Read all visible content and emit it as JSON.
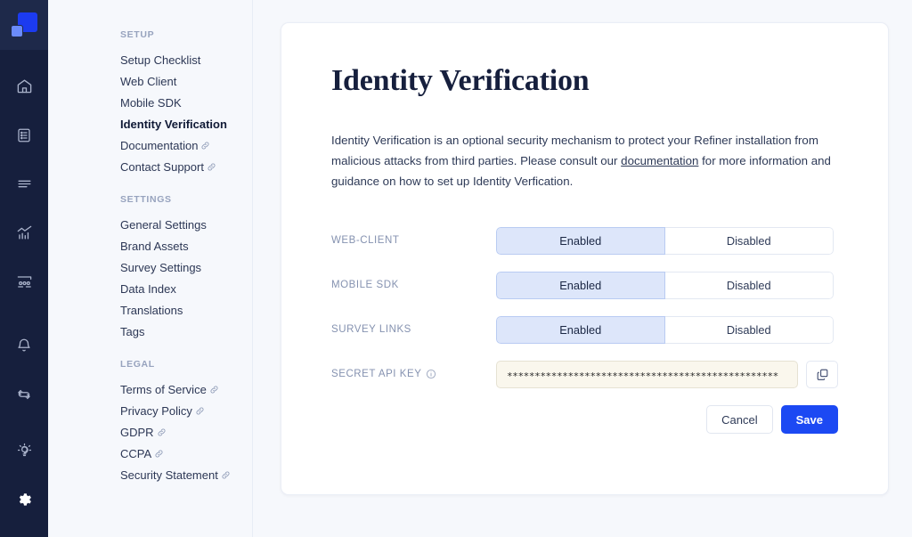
{
  "brand": {
    "logo_name": "refiner-logo",
    "accent_color": "#1c3bf0",
    "save_color": "#1c49f3"
  },
  "rail": {
    "icons": [
      {
        "name": "home-icon",
        "label": "Home"
      },
      {
        "name": "clipboard-list-icon",
        "label": "Surveys"
      },
      {
        "name": "menu-lines-icon",
        "label": "Responses"
      },
      {
        "name": "chart-icon",
        "label": "Analytics"
      },
      {
        "name": "people-icon",
        "label": "Audience"
      },
      {
        "name": "bell-icon",
        "label": "Notifications"
      },
      {
        "name": "sync-icon",
        "label": "Integrations"
      },
      {
        "name": "lightbulb-icon",
        "label": "Insights"
      },
      {
        "name": "gear-icon",
        "label": "Settings"
      }
    ]
  },
  "nav": {
    "sections": [
      {
        "title": "SETUP",
        "items": [
          {
            "label": "Setup Checklist",
            "external": false,
            "active": false
          },
          {
            "label": "Web Client",
            "external": false,
            "active": false
          },
          {
            "label": "Mobile SDK",
            "external": false,
            "active": false
          },
          {
            "label": "Identity Verification",
            "external": false,
            "active": true
          },
          {
            "label": "Documentation",
            "external": true,
            "active": false
          },
          {
            "label": "Contact Support",
            "external": true,
            "active": false
          }
        ]
      },
      {
        "title": "SETTINGS",
        "items": [
          {
            "label": "General Settings",
            "external": false,
            "active": false
          },
          {
            "label": "Brand Assets",
            "external": false,
            "active": false
          },
          {
            "label": "Survey Settings",
            "external": false,
            "active": false
          },
          {
            "label": "Data Index",
            "external": false,
            "active": false
          },
          {
            "label": "Translations",
            "external": false,
            "active": false
          },
          {
            "label": "Tags",
            "external": false,
            "active": false
          }
        ]
      },
      {
        "title": "LEGAL",
        "items": [
          {
            "label": "Terms of Service",
            "external": true,
            "active": false
          },
          {
            "label": "Privacy Policy",
            "external": true,
            "active": false
          },
          {
            "label": "GDPR",
            "external": true,
            "active": false
          },
          {
            "label": "CCPA",
            "external": true,
            "active": false
          },
          {
            "label": "Security Statement",
            "external": true,
            "active": false
          }
        ]
      }
    ]
  },
  "page": {
    "title": "Identity Verification",
    "intro_before_link": "Identity Verification is an optional security mechanism to protect your Refiner installation from malicious attacks from third parties. Please consult our ",
    "intro_link": "documentation",
    "intro_after_link": " for more information and guidance on how to set up Identity Verfication."
  },
  "form": {
    "toggle_rows": [
      {
        "label": "WEB-CLIENT",
        "options": [
          "Enabled",
          "Disabled"
        ],
        "selected": "Enabled"
      },
      {
        "label": "MOBILE SDK",
        "options": [
          "Enabled",
          "Disabled"
        ],
        "selected": "Enabled"
      },
      {
        "label": "SURVEY LINKS",
        "options": [
          "Enabled",
          "Disabled"
        ],
        "selected": "Enabled"
      }
    ],
    "api_key_row": {
      "label": "SECRET API KEY",
      "info_icon": "info-circle-icon",
      "value": "*************************************************",
      "copy_icon": "copy-icon"
    }
  },
  "actions": {
    "cancel_label": "Cancel",
    "save_label": "Save"
  }
}
